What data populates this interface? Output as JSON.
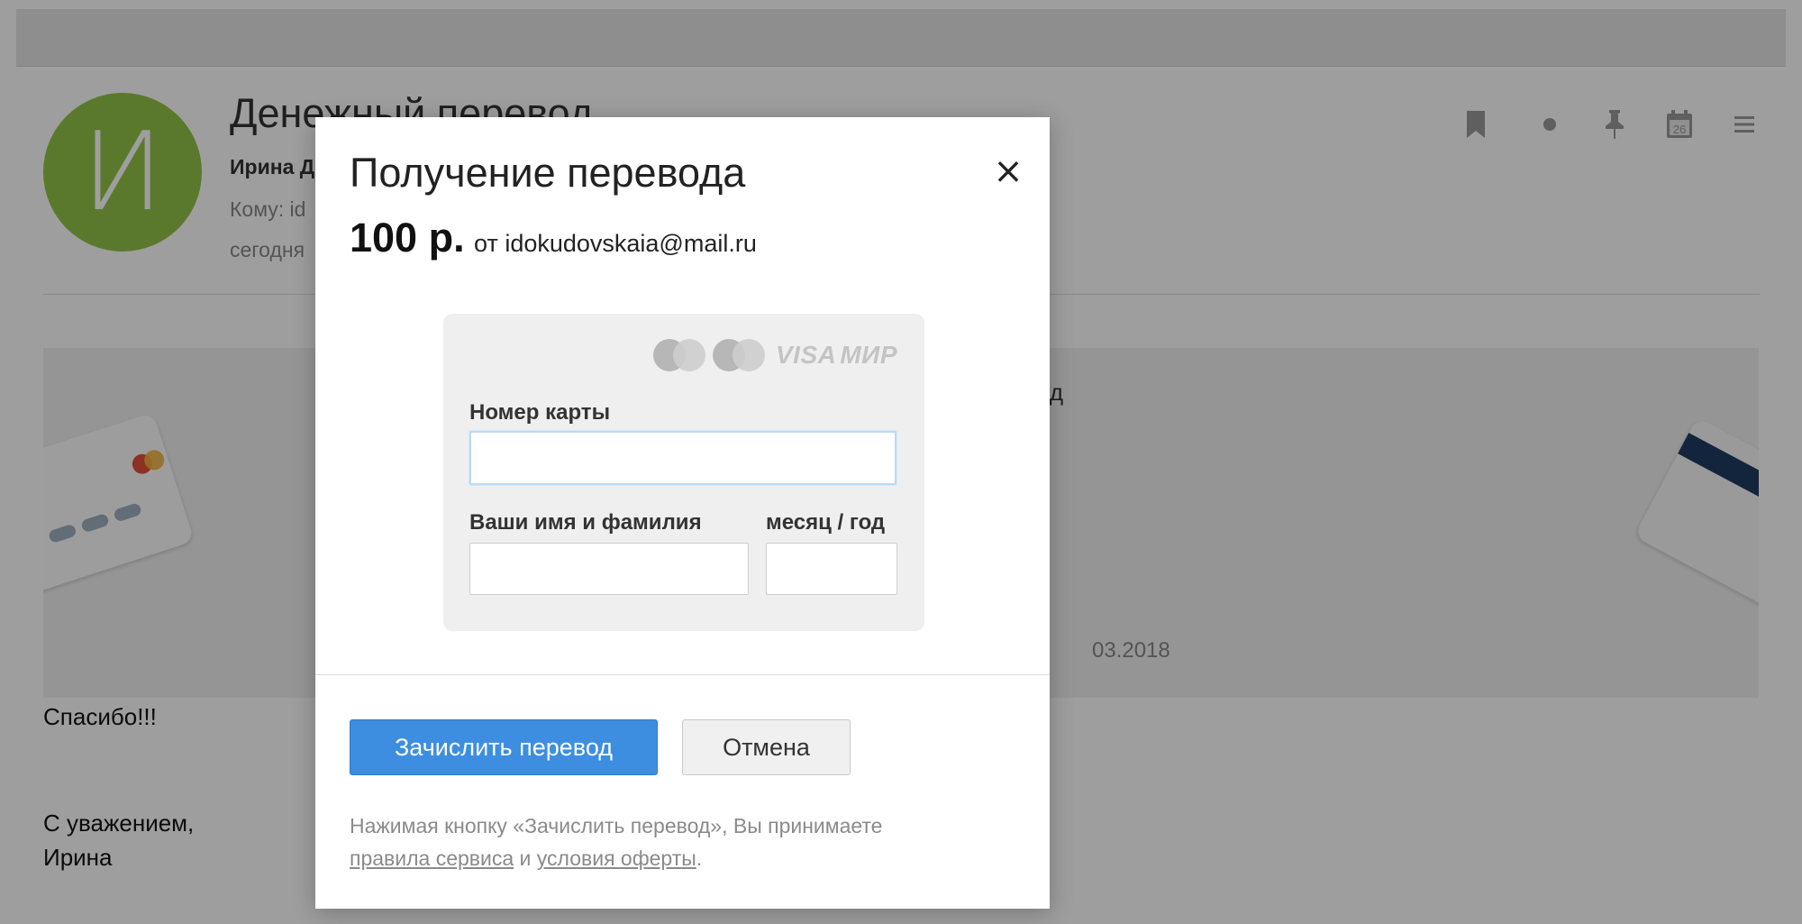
{
  "email": {
    "avatar_letter": "И",
    "subject": "Денежный перевод",
    "sender": "Ирина Д",
    "recipient": "Кому: id",
    "date": "сегодня",
    "promo_text": "евод",
    "promo_date": "03.2018",
    "thanks": "Спасибо!!!",
    "regards": "С уважением,",
    "signature": "Ирина"
  },
  "header_icons": [
    "bookmark-icon",
    "dot-icon",
    "pin-icon",
    "calendar-icon",
    "menu-icon"
  ],
  "calendar_day": "26",
  "modal": {
    "title": "Получение перевода",
    "close_symbol": "×",
    "amount": "100 р.",
    "from_text": "от idokudovskaia@mail.ru",
    "brands": {
      "visa": "VISA",
      "mir": "МИР"
    },
    "card_number_label": "Номер карты",
    "card_number_value": "",
    "name_label": "Ваши имя и фамилия",
    "name_value": "",
    "expiry_label": "месяц / год",
    "expiry_value": "",
    "submit_label": "Зачислить перевод",
    "cancel_label": "Отмена",
    "disclaimer_prefix": "Нажимая кнопку «Зачислить перевод», Вы принимаете",
    "rules_link": "правила сервиса",
    "conjunction": "и",
    "offer_link": "условия оферты",
    "period": "."
  },
  "colors": {
    "primary_button": "#3d8ee0",
    "avatar": "#94c447",
    "overlay": "rgba(0,0,0,0.38)"
  }
}
